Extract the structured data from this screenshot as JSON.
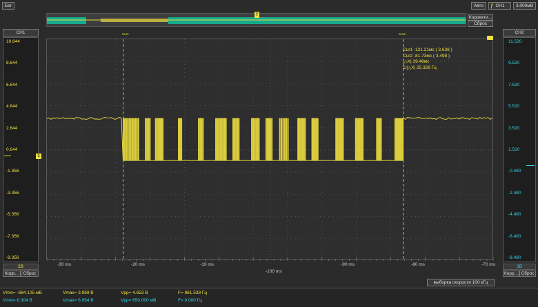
{
  "toolbar": {
    "run_label": "Бег",
    "auto_label": "Авто",
    "channel_label": "CH1",
    "trigger_level": "3.000мВ",
    "correct_label": "Корректи...",
    "reset_label": "Сброс",
    "trigger_marker": "T"
  },
  "ch1": {
    "title": "CH1",
    "ticks": [
      "10.644",
      "8.644",
      "6.644",
      "4.644",
      "2.644",
      "0.644",
      "-1.356",
      "-3.356",
      "-5.356",
      "-7.356",
      "-9.356"
    ],
    "scale": "2В",
    "correct_label": "Корр...",
    "reset_label": "Сброс",
    "marker": "1",
    "color": "#f0e040"
  },
  "ch2": {
    "title": "CH2",
    "ticks": [
      "11.520",
      "9.520",
      "7.520",
      "5.520",
      "3.520",
      "1.520",
      "-0.480",
      "-2.480",
      "-4.480",
      "-6.480",
      "-8.480"
    ],
    "scale": "2В",
    "correct_label": "Корр...",
    "reset_label": "Сброс",
    "color": "#30d8e8"
  },
  "xaxis": {
    "ticks": [
      "-30 ms",
      "-20 ms",
      "-10 ms",
      "-100 ms",
      "-90 ms",
      "-80 ms",
      "-70 ms"
    ],
    "center_label": "-100 ms"
  },
  "cursors": {
    "cur1_tag": "Cur1",
    "cur2_tag": "Cur2",
    "cur1": "Cur1    -121.21мс ( 3.638 )",
    "cur2": "Cur2    -81.73мс ( 3.498 )",
    "delta": "|△X|    39.48мс",
    "freq": "1/|△X|  25.328 Гц"
  },
  "sample_rate": "выборка скорости 100 кГц",
  "measurements": {
    "ch1": {
      "vmin": "Vmin= -684.105 мВ",
      "vmax": "Vmax= 3.969 В",
      "vpp": "Vpp= 4.653 В",
      "f": "F= 961.538 Гц"
    },
    "ch2": {
      "vmin": "Vmin= 6.304 В",
      "vmax": "Vmax= 6.954 В",
      "vpp": "Vpp= 650.000 мВ",
      "f": "F= 0.000 Гц"
    }
  },
  "waveform": {
    "high_level_v": 3.5,
    "low_level_v": -0.3,
    "bursts_ms": [
      [
        -21.5,
        -19.2
      ],
      [
        -18.4,
        -17.6
      ],
      [
        -17.0,
        -15.8
      ],
      [
        -13.8,
        -13.2
      ],
      [
        -11.0,
        -10.2
      ],
      [
        -8.6,
        -7.0
      ],
      [
        -6.2,
        -5.2
      ],
      [
        -3.6,
        -2.4
      ],
      [
        -1.6,
        -0.6
      ],
      [
        -99.4,
        -98.0
      ],
      [
        -96.8,
        -95.6
      ],
      [
        -94.8,
        -93.8
      ],
      [
        -91.4,
        -90.2
      ],
      [
        -88.6,
        -87.4
      ],
      [
        -85.6,
        -84.8
      ],
      [
        -83.0,
        -81.8
      ]
    ]
  }
}
